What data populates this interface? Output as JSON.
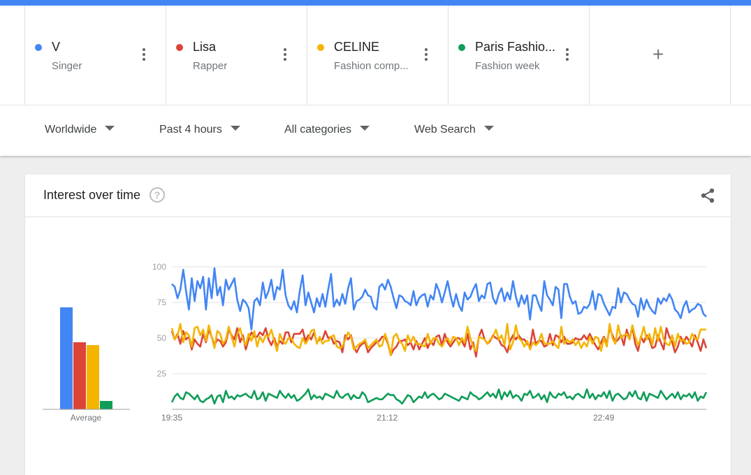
{
  "terms": [
    {
      "name": "V",
      "subtitle": "Singer",
      "color": "#4285f4"
    },
    {
      "name": "Lisa",
      "subtitle": "Rapper",
      "color": "#db4437"
    },
    {
      "name": "CELINE",
      "subtitle": "Fashion comp...",
      "color": "#f4b400"
    },
    {
      "name": "Paris Fashio...",
      "subtitle": "Fashion week",
      "color": "#0f9d58"
    }
  ],
  "add_term_label": "+",
  "filters": {
    "region": "Worldwide",
    "time": "Past 4 hours",
    "category": "All categories",
    "search_type": "Web Search"
  },
  "card": {
    "title": "Interest over time",
    "help_glyph": "?"
  },
  "chart_data": [
    {
      "type": "bar",
      "categories": [
        "V",
        "Lisa",
        "CELINE",
        "Paris Fashion Week"
      ],
      "values": [
        73,
        48,
        46,
        6
      ],
      "xlabel": "Average",
      "colors": [
        "#4285f4",
        "#db4437",
        "#f4b400",
        "#0f9d58"
      ]
    },
    {
      "type": "line",
      "x_ticks": [
        "19:35",
        "21:12",
        "22:49"
      ],
      "y_ticks": [
        25,
        50,
        75,
        100
      ],
      "ylim": [
        0,
        100
      ],
      "grid": true,
      "series": [
        {
          "name": "V",
          "color": "#4285f4",
          "values": [
            88,
            86,
            78,
            84,
            98,
            83,
            70,
            92,
            76,
            90,
            85,
            93,
            70,
            92,
            78,
            99,
            80,
            86,
            73,
            91,
            84,
            88,
            92,
            77,
            69,
            77,
            75,
            71,
            56,
            76,
            78,
            73,
            89,
            78,
            83,
            91,
            77,
            86,
            84,
            98,
            80,
            73,
            70,
            76,
            68,
            83,
            94,
            73,
            82,
            75,
            68,
            78,
            72,
            81,
            72,
            84,
            95,
            72,
            77,
            73,
            81,
            74,
            85,
            92,
            70,
            76,
            77,
            79,
            84,
            80,
            79,
            72,
            70,
            86,
            88,
            84,
            91,
            86,
            78,
            71,
            80,
            79,
            76,
            75,
            73,
            83,
            73,
            78,
            80,
            81,
            72,
            80,
            77,
            88,
            83,
            75,
            82,
            90,
            80,
            72,
            81,
            73,
            69,
            82,
            77,
            79,
            84,
            88,
            76,
            80,
            78,
            88,
            89,
            78,
            74,
            81,
            85,
            76,
            82,
            77,
            90,
            79,
            72,
            80,
            74,
            80,
            63,
            80,
            80,
            74,
            69,
            90,
            80,
            77,
            73,
            86,
            84,
            64,
            88,
            88,
            79,
            74,
            76,
            67,
            68,
            72,
            71,
            74,
            83,
            70,
            81,
            80,
            74,
            70,
            66,
            72,
            71,
            85,
            75,
            82,
            81,
            77,
            74,
            73,
            65,
            78,
            70,
            77,
            72,
            69,
            67,
            78,
            74,
            78,
            76,
            81,
            77,
            70,
            68,
            64,
            72,
            76,
            68,
            70,
            71,
            74,
            73,
            67,
            65
          ]
        },
        {
          "name": "Lisa",
          "color": "#db4437",
          "values": [
            55,
            49,
            53,
            46,
            55,
            49,
            51,
            42,
            49,
            46,
            44,
            53,
            47,
            56,
            51,
            45,
            49,
            48,
            44,
            47,
            56,
            52,
            49,
            57,
            47,
            52,
            42,
            49,
            54,
            51,
            51,
            54,
            52,
            57,
            49,
            45,
            50,
            44,
            48,
            46,
            54,
            54,
            47,
            53,
            53,
            53,
            56,
            48,
            52,
            49,
            54,
            47,
            49,
            49,
            55,
            50,
            51,
            46,
            48,
            47,
            40,
            52,
            49,
            52,
            44,
            40,
            44,
            46,
            47,
            40,
            43,
            45,
            47,
            48,
            51,
            51,
            46,
            38,
            42,
            44,
            48,
            48,
            49,
            45,
            47,
            42,
            48,
            42,
            46,
            50,
            43,
            48,
            45,
            51,
            52,
            45,
            53,
            47,
            44,
            47,
            50,
            50,
            48,
            44,
            53,
            42,
            47,
            37,
            51,
            56,
            49,
            46,
            48,
            52,
            50,
            49,
            45,
            44,
            40,
            48,
            52,
            49,
            52,
            49,
            49,
            46,
            44,
            56,
            46,
            48,
            48,
            44,
            45,
            53,
            45,
            52,
            51,
            47,
            51,
            46,
            46,
            47,
            50,
            49,
            49,
            52,
            49,
            53,
            49,
            45,
            42,
            47,
            51,
            46,
            57,
            52,
            47,
            49,
            52,
            45,
            56,
            49,
            58,
            46,
            41,
            51,
            47,
            52,
            49,
            43,
            44,
            52,
            47,
            42,
            57,
            51,
            47,
            40,
            44,
            51,
            46,
            51,
            48,
            44,
            52,
            47,
            41,
            49,
            43
          ]
        },
        {
          "name": "CELINE",
          "color": "#f4b400",
          "values": [
            57,
            49,
            52,
            60,
            47,
            54,
            52,
            44,
            57,
            58,
            52,
            56,
            48,
            59,
            51,
            43,
            55,
            53,
            46,
            49,
            58,
            51,
            44,
            53,
            57,
            49,
            45,
            53,
            48,
            55,
            44,
            51,
            47,
            52,
            51,
            56,
            48,
            41,
            53,
            48,
            46,
            50,
            50,
            46,
            44,
            43,
            50,
            46,
            49,
            55,
            56,
            46,
            51,
            46,
            48,
            48,
            51,
            52,
            44,
            43,
            44,
            49,
            54,
            51,
            42,
            44,
            46,
            47,
            49,
            43,
            45,
            47,
            49,
            44,
            45,
            53,
            47,
            38,
            51,
            53,
            48,
            46,
            41,
            52,
            47,
            51,
            46,
            46,
            45,
            44,
            53,
            46,
            50,
            50,
            46,
            44,
            48,
            50,
            46,
            51,
            50,
            45,
            50,
            47,
            58,
            50,
            44,
            41,
            51,
            50,
            49,
            46,
            49,
            51,
            56,
            49,
            52,
            45,
            60,
            42,
            47,
            59,
            50,
            48,
            44,
            48,
            42,
            47,
            45,
            47,
            53,
            46,
            46,
            46,
            48,
            45,
            43,
            58,
            46,
            49,
            47,
            49,
            45,
            48,
            43,
            47,
            44,
            51,
            46,
            51,
            50,
            41,
            50,
            44,
            60,
            50,
            46,
            59,
            50,
            52,
            53,
            49,
            59,
            51,
            45,
            50,
            58,
            49,
            53,
            45,
            57,
            48,
            58,
            49,
            46,
            45,
            52,
            44,
            53,
            48,
            49,
            46,
            47,
            53,
            50,
            49,
            56,
            56,
            56
          ]
        },
        {
          "name": "Paris Fashion Week",
          "color": "#0f9d58",
          "values": [
            5,
            9,
            11,
            8,
            7,
            12,
            11,
            9,
            7,
            10,
            6,
            5,
            7,
            8,
            10,
            4,
            9,
            10,
            5,
            13,
            8,
            9,
            7,
            10,
            9,
            10,
            11,
            9,
            8,
            13,
            7,
            8,
            12,
            6,
            11,
            10,
            9,
            8,
            13,
            10,
            8,
            11,
            8,
            10,
            6,
            7,
            9,
            11,
            14,
            7,
            10,
            8,
            9,
            7,
            11,
            10,
            9,
            8,
            13,
            9,
            8,
            10,
            11,
            7,
            10,
            8,
            8,
            12,
            10,
            5,
            6,
            7,
            8,
            7,
            7,
            9,
            11,
            10,
            10,
            7,
            6,
            4,
            7,
            10,
            9,
            5,
            7,
            9,
            8,
            12,
            8,
            10,
            11,
            9,
            7,
            8,
            11,
            10,
            9,
            8,
            7,
            6,
            9,
            8,
            7,
            12,
            10,
            9,
            7,
            8,
            10,
            12,
            9,
            11,
            8,
            14,
            7,
            12,
            9,
            13,
            8,
            10,
            9,
            6,
            11,
            10,
            13,
            8,
            9,
            11,
            7,
            10,
            5,
            12,
            9,
            8,
            11,
            10,
            12,
            8,
            9,
            7,
            10,
            11,
            9,
            8,
            14,
            8,
            11,
            7,
            10,
            9,
            12,
            8,
            13,
            6,
            10,
            11,
            9,
            7,
            8,
            12,
            9,
            13,
            8,
            7,
            12,
            6,
            11,
            10,
            9,
            8,
            13,
            10,
            7,
            9,
            11,
            8,
            12,
            7,
            10,
            9,
            11,
            8,
            12,
            6,
            9,
            8,
            12
          ]
        }
      ]
    }
  ]
}
